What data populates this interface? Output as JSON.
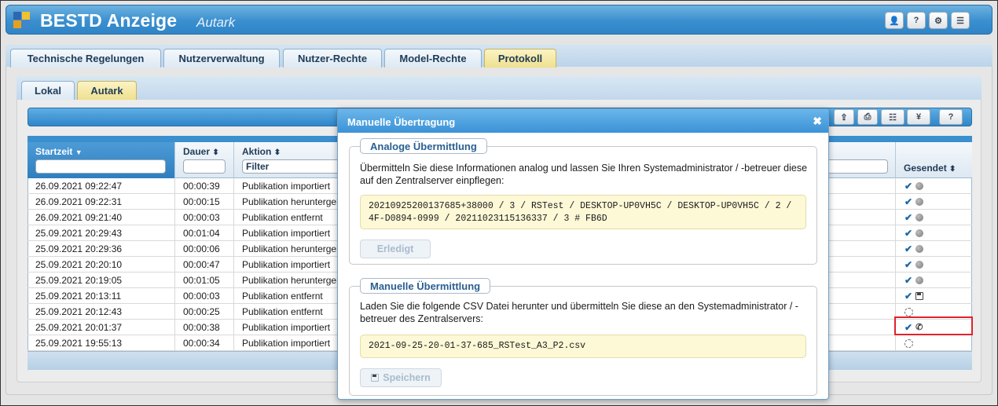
{
  "header": {
    "title": "BESTD Anzeige",
    "subtitle": "Autark",
    "buttons": [
      {
        "name": "user-icon",
        "glyph": "👤"
      },
      {
        "name": "help-icon",
        "glyph": "?"
      },
      {
        "name": "gear-icon",
        "glyph": "⚙"
      },
      {
        "name": "menu-icon",
        "glyph": "☰"
      }
    ],
    "logo_colors": [
      "#2e67b1",
      "#f2c12e",
      "#e6a11c",
      "#3f86cc"
    ]
  },
  "main_tabs": [
    {
      "label": "Technische Regelungen",
      "active": false
    },
    {
      "label": "Nutzerverwaltung",
      "active": false
    },
    {
      "label": "Nutzer-Rechte",
      "active": false
    },
    {
      "label": "Model-Rechte",
      "active": false
    },
    {
      "label": "Protokoll",
      "active": true
    }
  ],
  "sub_tabs": [
    {
      "label": "Lokal",
      "active": false
    },
    {
      "label": "Autark",
      "active": true
    }
  ],
  "toolbar": {
    "buttons": [
      {
        "name": "upload-icon",
        "glyph": "⇪"
      },
      {
        "name": "export-file-icon",
        "glyph": "⎙"
      },
      {
        "name": "list-icon",
        "glyph": "☷"
      },
      {
        "name": "yen-icon",
        "glyph": "¥"
      },
      {
        "name": "help-icon",
        "glyph": "?"
      }
    ]
  },
  "grid": {
    "columns": {
      "start": "Startzeit",
      "duration": "Dauer",
      "action": "Aktion",
      "sent": "Gesendet"
    },
    "filters": {
      "start": "",
      "duration": "",
      "action": "Filter",
      "other": ""
    },
    "sort_indicator": "▼",
    "sortable_indicator": "⬍",
    "rows": [
      {
        "start": "26.09.2021 09:22:47",
        "duration": "00:00:39",
        "action": "Publikation importiert",
        "status": [
          "check",
          "globe"
        ]
      },
      {
        "start": "26.09.2021 09:22:31",
        "duration": "00:00:15",
        "action": "Publikation heruntergeladen",
        "status": [
          "check",
          "globe"
        ]
      },
      {
        "start": "26.09.2021 09:21:40",
        "duration": "00:00:03",
        "action": "Publikation entfernt",
        "status": [
          "check",
          "globe"
        ]
      },
      {
        "start": "25.09.2021 20:29:43",
        "duration": "00:01:04",
        "action": "Publikation importiert",
        "status": [
          "check",
          "globe"
        ]
      },
      {
        "start": "25.09.2021 20:29:36",
        "duration": "00:00:06",
        "action": "Publikation heruntergeladen",
        "status": [
          "check",
          "globe"
        ]
      },
      {
        "start": "25.09.2021 20:20:10",
        "duration": "00:00:47",
        "action": "Publikation importiert",
        "status": [
          "check",
          "globe"
        ]
      },
      {
        "start": "25.09.2021 20:19:05",
        "duration": "00:01:05",
        "action": "Publikation heruntergeladen",
        "status": [
          "check",
          "globe"
        ]
      },
      {
        "start": "25.09.2021 20:13:11",
        "duration": "00:00:03",
        "action": "Publikation entfernt",
        "status": [
          "check",
          "floppy"
        ]
      },
      {
        "start": "25.09.2021 20:12:43",
        "duration": "00:00:25",
        "action": "Publikation entfernt",
        "status": [
          "spinner"
        ]
      },
      {
        "start": "25.09.2021 20:01:37",
        "duration": "00:00:38",
        "action": "Publikation importiert",
        "status": [
          "check",
          "phone"
        ]
      },
      {
        "start": "25.09.2021 19:55:13",
        "duration": "00:00:34",
        "action": "Publikation importiert",
        "status": [
          "spinner"
        ]
      }
    ],
    "status_glyphs": {
      "check": "✔",
      "phone": "✆"
    }
  },
  "modal": {
    "title": "Manuelle Übertragung",
    "close_glyph": "✖",
    "analog": {
      "legend": "Analoge Übermittlung",
      "message": "Übermitteln Sie diese Informationen analog und lassen Sie Ihren Systemadministrator / -betreuer diese auf den Zentralserver einpflegen:",
      "code": "20210925200137685+38000 / 3 / RSTest / DESKTOP-UP0VH5C / DESKTOP-UP0VH5C / 2 / 4F-D0894-0999 / 20211023115136337 / 3 # FB6D",
      "button": "Erledigt"
    },
    "manual": {
      "legend": "Manuelle Übermittlung",
      "message": "Laden Sie die folgende CSV Datei herunter und übermitteln Sie diese an den Systemadministrator / -betreuer des Zentralservers:",
      "file": "2021-09-25-20-01-37-685_RSTest_A3_P2.csv",
      "button": "Speichern",
      "button_icon": "floppy-icon"
    }
  },
  "colors": {
    "header_blue": "#3a8fcf",
    "active_tab": "#efe08e",
    "highlight": "#e0232b"
  }
}
